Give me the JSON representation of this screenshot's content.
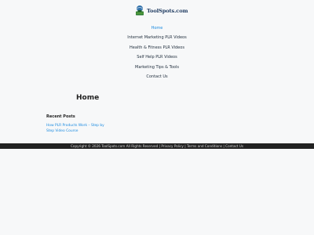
{
  "header": {
    "logo_text": "ToolSpots.com",
    "logo_icon": "toolbox-globe-icon"
  },
  "nav": {
    "items": [
      {
        "label": "Home",
        "active": true
      },
      {
        "label": "Internet Marketing PLR Videos",
        "active": false
      },
      {
        "label": "Health & Fitness PLR Videos",
        "active": false
      },
      {
        "label": "Self Help PLR Videos",
        "active": false
      },
      {
        "label": "Marketing Tips & Tools",
        "active": false
      },
      {
        "label": "Contact Us",
        "active": false
      }
    ]
  },
  "main": {
    "title": "Home"
  },
  "sidebar": {
    "recent_title": "Recent Posts",
    "recent_posts": [
      {
        "label": "How PLR Products Work – Step by Step Video Course"
      }
    ]
  },
  "footer": {
    "copyright": "Copyright © 2026 ToolSpots.com All Rights Reserved |",
    "privacy": "Privacy Policy",
    "sep1": "|",
    "terms": "Terms and Conditions",
    "sep2": "|",
    "contact": "Contact Us"
  },
  "colors": {
    "background": "#f7f8f9",
    "link": "#1b8be0",
    "footer_bg": "#222222",
    "logo_text": "#1f3b61"
  }
}
